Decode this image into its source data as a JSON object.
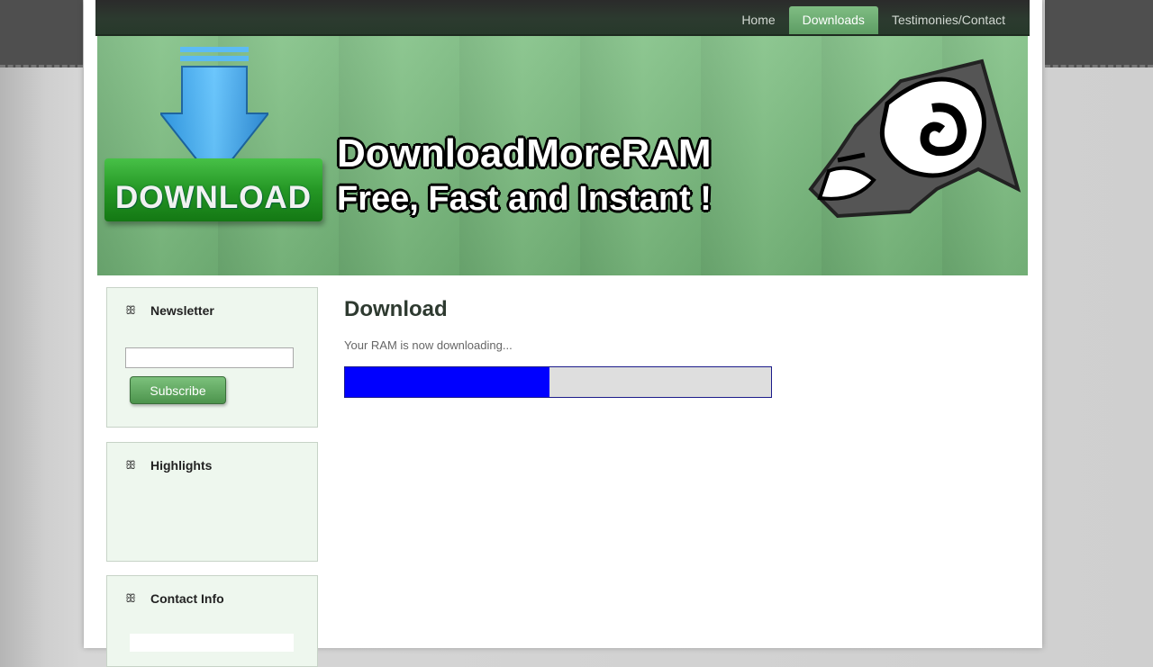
{
  "nav": {
    "items": [
      {
        "label": "Home",
        "active": false
      },
      {
        "label": "Downloads",
        "active": true
      },
      {
        "label": "Testimonies/Contact",
        "active": false
      }
    ]
  },
  "banner": {
    "badge_text": "DOWNLOAD",
    "title": "DownloadMoreRAM",
    "subtitle": "Free, Fast and Instant !"
  },
  "sidebar": {
    "newsletter": {
      "title": "Newsletter",
      "input_value": "",
      "button_label": "Subscribe"
    },
    "highlights": {
      "title": "Highlights"
    },
    "contact": {
      "title": "Contact Info"
    }
  },
  "main": {
    "heading": "Download",
    "status": "Your RAM is now downloading...",
    "progress_percent": 48
  },
  "colors": {
    "progress_fill": "#0000ff",
    "nav_active": "#6aa96f",
    "banner_green": "#7ebf82"
  },
  "icons": {
    "widget_bullet": "knot-icon",
    "banner_arrow": "download-arrow-icon",
    "banner_mascot": "ram-head-logo"
  }
}
